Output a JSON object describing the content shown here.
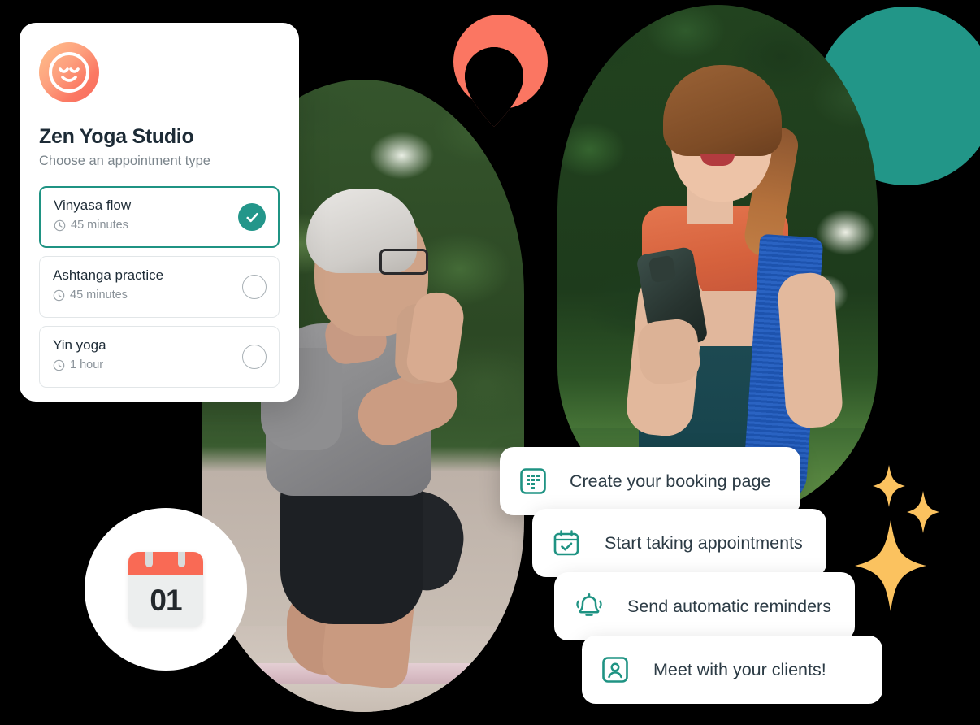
{
  "card": {
    "logo_icon": "smiley-face-logo",
    "title": "Zen Yoga Studio",
    "subtitle": "Choose an appointment type",
    "clock_icon": "clock-icon",
    "options": [
      {
        "name": "Vinyasa flow",
        "duration": "45 minutes",
        "selected": true,
        "control_icon": "check-circle-icon"
      },
      {
        "name": "Ashtanga practice",
        "duration": "45 minutes",
        "selected": false,
        "control_icon": "radio-empty-icon"
      },
      {
        "name": "Yin yoga",
        "duration": "1 hour",
        "selected": false,
        "control_icon": "radio-empty-icon"
      }
    ]
  },
  "calendar": {
    "day": "01",
    "icon": "calendar-date-icon"
  },
  "pills": [
    {
      "label": "Create your booking page",
      "icon": "booking-page-icon"
    },
    {
      "label": "Start taking appointments",
      "icon": "calendar-check-icon"
    },
    {
      "label": "Send automatic reminders",
      "icon": "bell-ring-icon"
    },
    {
      "label": "Meet with your clients!",
      "icon": "contact-card-icon"
    }
  ],
  "decor": {
    "coral_pin": "coral-pin-shape",
    "coral_circle": "coral-circle-shape",
    "teal_circle": "teal-circle-shape",
    "sparkles": [
      "sparkle-small",
      "sparkle-medium",
      "sparkle-large"
    ]
  },
  "photos": [
    {
      "name": "man-doing-yoga-photo"
    },
    {
      "name": "woman-with-yoga-mat-photo"
    }
  ],
  "colors": {
    "teal": "#229688",
    "coral": "#FB7662",
    "amber": "#FBC25F",
    "ink": "#1D2B36",
    "muted": "#8A9299"
  }
}
